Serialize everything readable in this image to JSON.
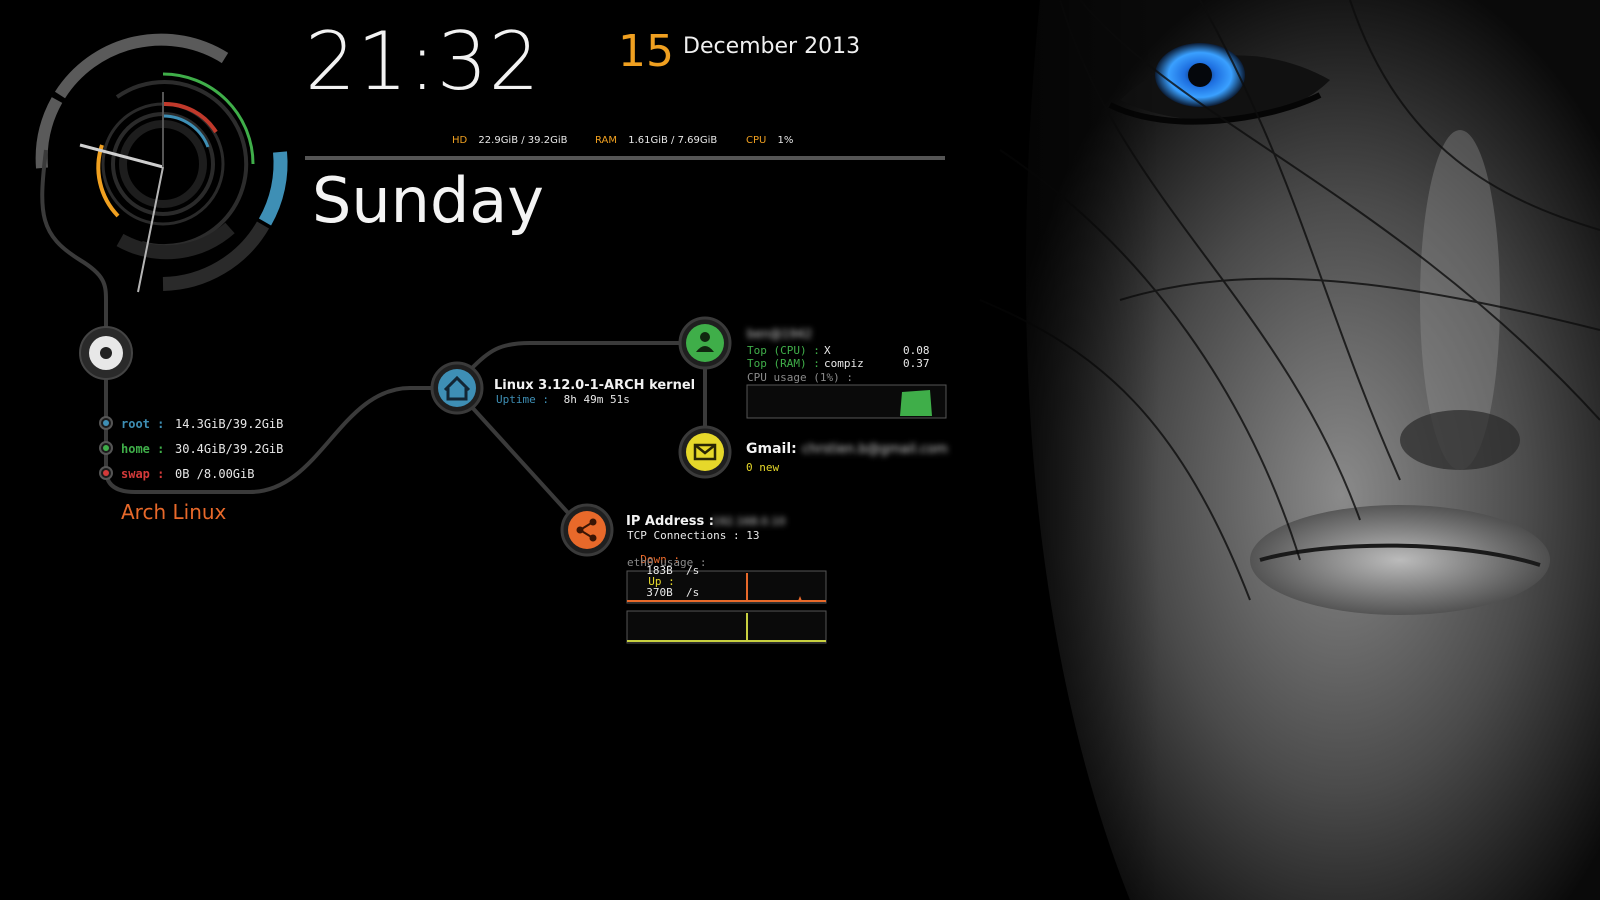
{
  "clock": {
    "time": "21:32",
    "day_number": "15",
    "month_year": "December 2013",
    "weekday": "Sunday"
  },
  "stats": {
    "hd_label": "HD",
    "hd_value": "22.9GiB / 39.2GiB",
    "ram_label": "RAM",
    "ram_value": "1.61GiB / 7.69GiB",
    "cpu_label": "CPU",
    "cpu_value": "1%"
  },
  "disks": [
    {
      "label": "root :",
      "value": "14.3GiB/39.2GiB",
      "color": "#3e8fb5"
    },
    {
      "label": "home :",
      "value": "30.4GiB/39.2GiB",
      "color": "#3fae49"
    },
    {
      "label": "swap :",
      "value": "0B  /8.00GiB",
      "color": "#d43a3a"
    }
  ],
  "distro": "Arch Linux",
  "kernel": {
    "title": "Linux 3.12.0-1-ARCH kernel",
    "uptime_label": "Uptime :",
    "uptime_value": "8h 49m 51s"
  },
  "user": {
    "name_blurred": "ben@1942",
    "top_cpu_label": "Top (CPU) :",
    "top_cpu_proc": "X",
    "top_cpu_val": "0.08",
    "top_ram_label": "Top (RAM) :",
    "top_ram_proc": "compiz",
    "top_ram_val": "0.37",
    "cpu_usage_label": "CPU usage (1%) :"
  },
  "mail": {
    "label": "Gmail:",
    "address_blurred": "chrstien.b@gmail.com",
    "new_count": "0 new"
  },
  "network": {
    "ip_label": "IP Address :",
    "ip_blurred": "192.168.0.10",
    "tcp": "TCP Connections : 13",
    "down_label": "Down :",
    "down_value": "183B  /s",
    "up_label": "Up :",
    "up_value": "370B  /s",
    "eth_label": "eth0 usage :"
  },
  "colors": {
    "accent_orange": "#f0a020",
    "green": "#3fae49",
    "blue": "#3e8fb5",
    "red": "#d43a3a",
    "yellow": "#e6d82a",
    "net_orange": "#e8692a"
  },
  "icons": [
    "house-icon",
    "user-icon",
    "mail-icon",
    "share-icon",
    "record-icon"
  ]
}
